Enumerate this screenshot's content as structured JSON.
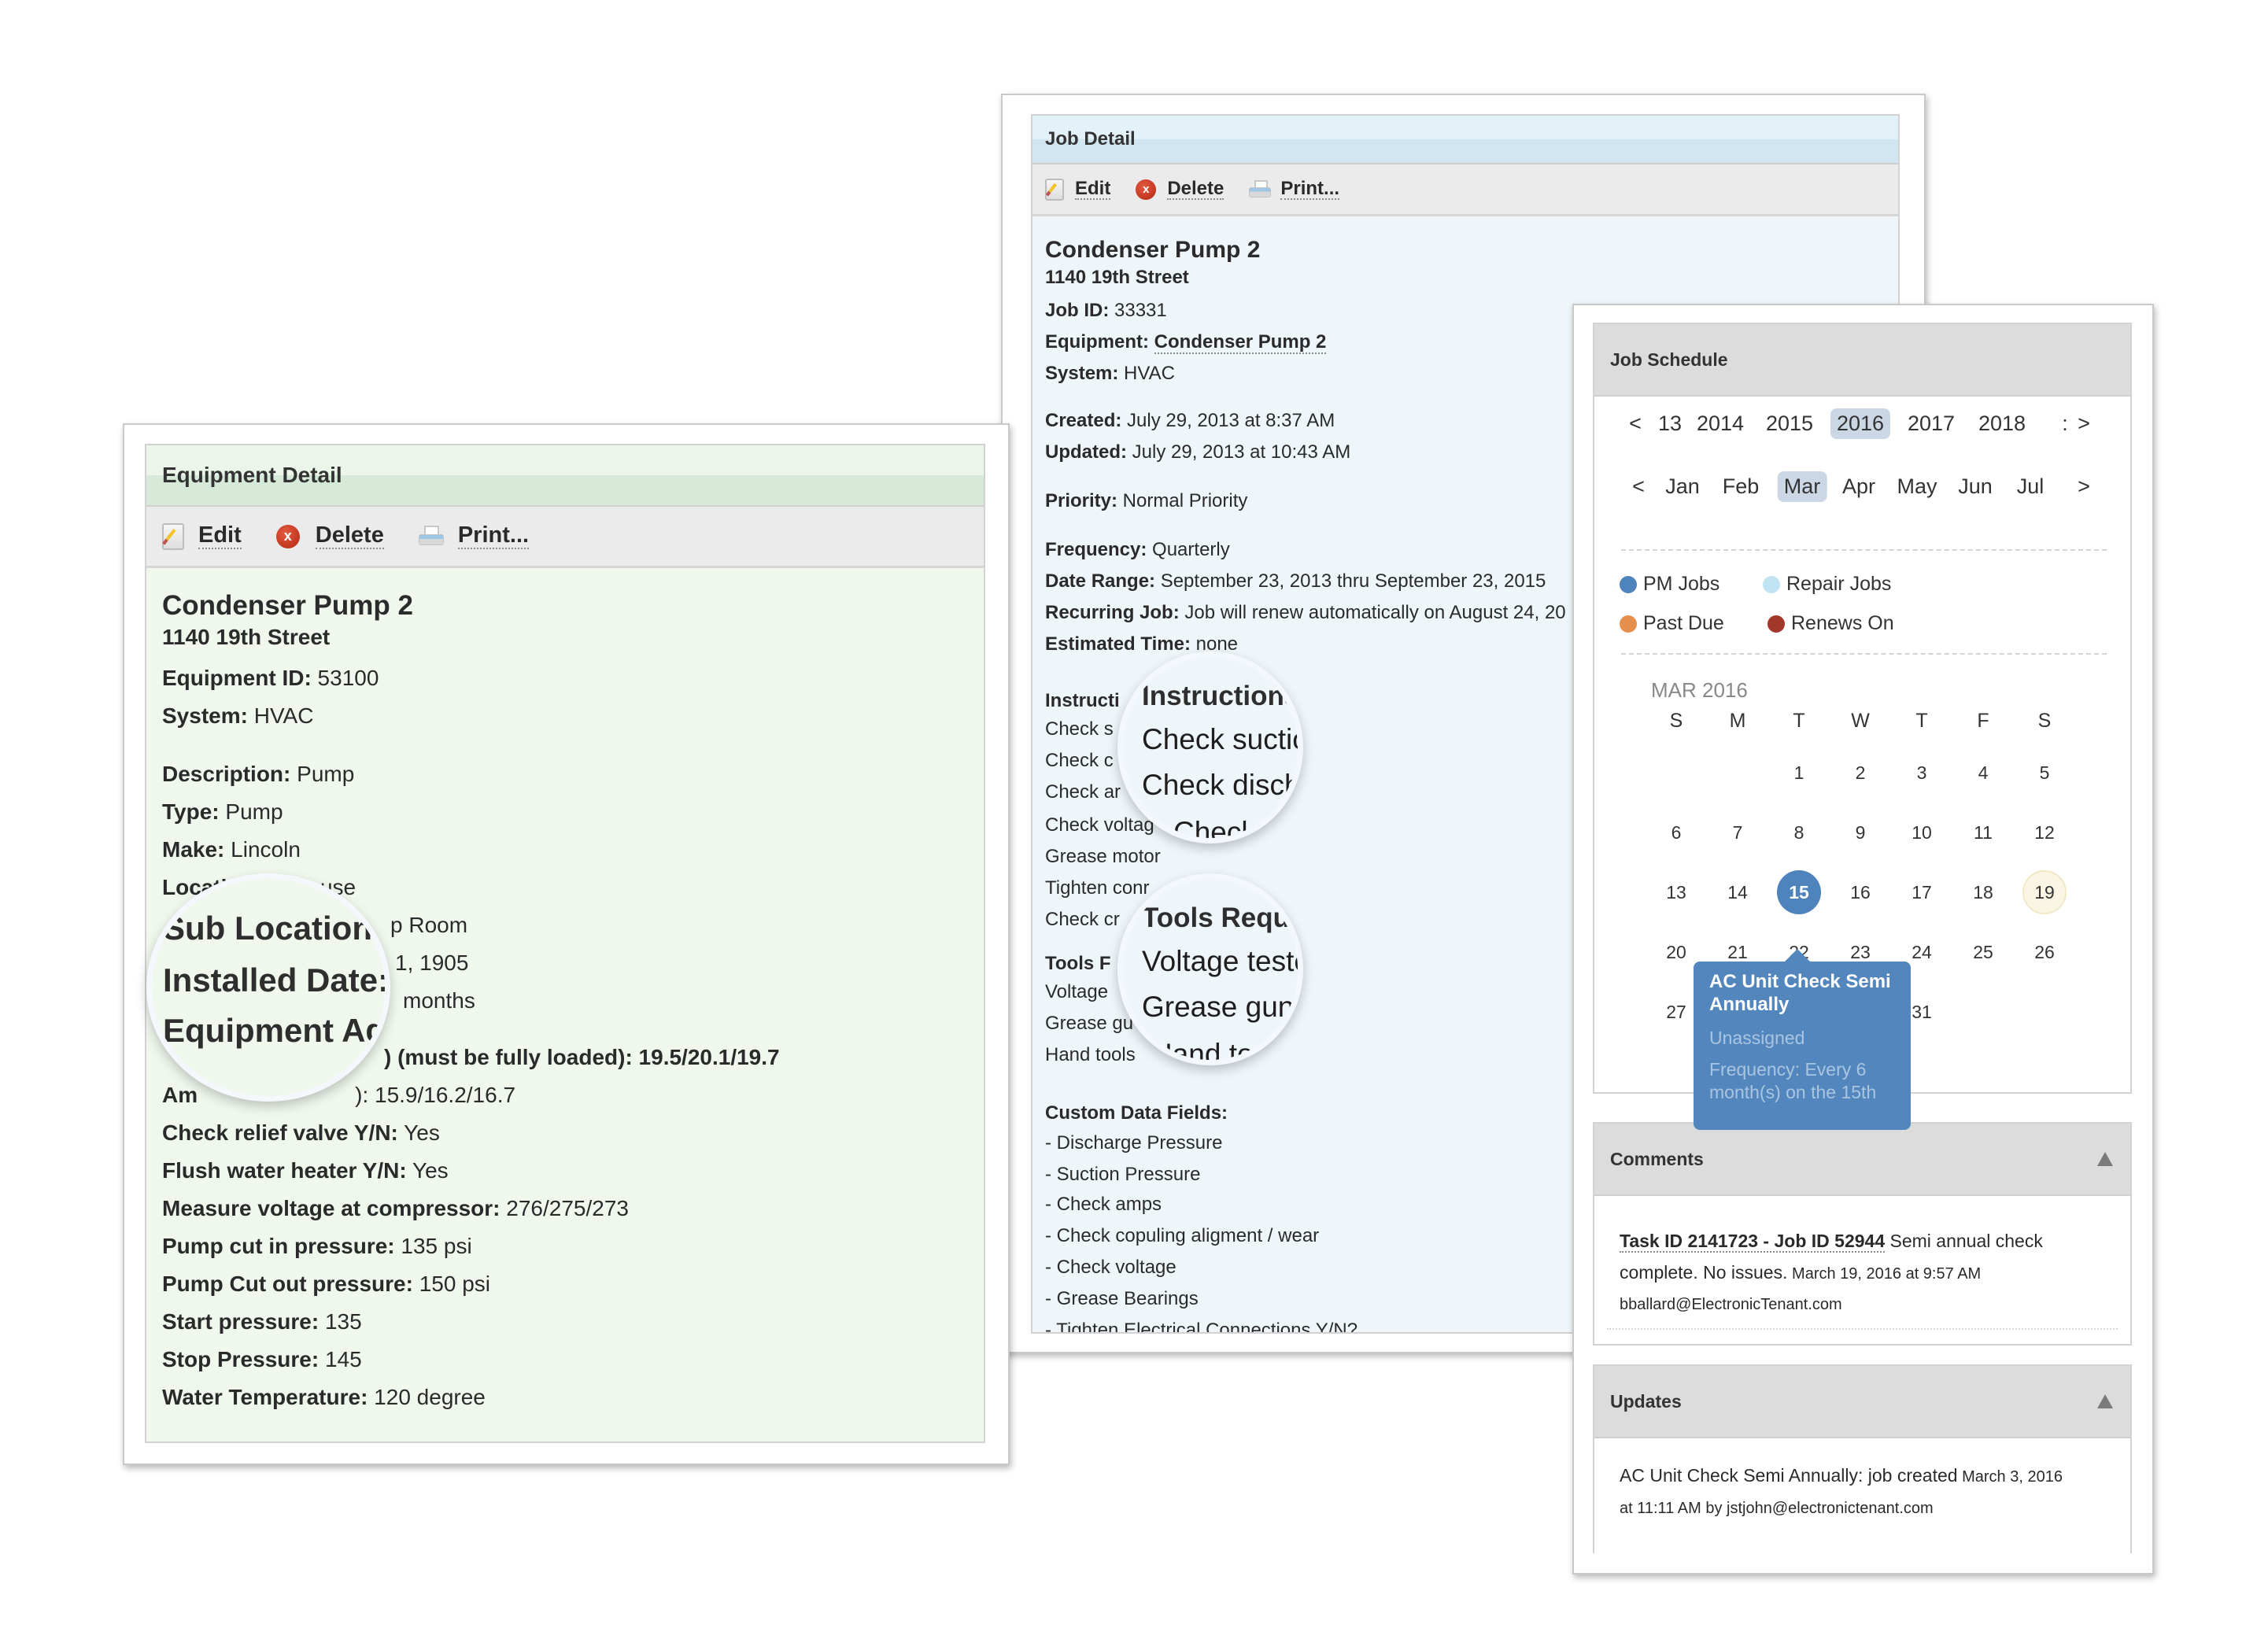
{
  "equipment_detail": {
    "header": "Equipment Detail",
    "toolbar": {
      "edit": "Edit",
      "delete": "Delete",
      "print": "Print..."
    },
    "title": "Condenser Pump 2",
    "address": "1140 19th Street",
    "fields": [
      {
        "label": "Equipment ID:",
        "value": " 53100"
      },
      {
        "label": "System:",
        "value": " HVAC"
      },
      {
        "label": "Description:",
        "value": " Pump"
      },
      {
        "label": "Type:",
        "value": " Pump"
      },
      {
        "label": "Make:",
        "value": " Lincoln"
      },
      {
        "label": "Location:",
        "value": " Penthouse"
      },
      {
        "label": "Sub Location:",
        "value": " Pump Room"
      },
      {
        "label": "Installed Date:",
        "value": " ...31, 1905"
      },
      {
        "label": "Equipment Age:",
        "value": " ... months"
      },
      {
        "label": "A... (must be fully loaded):",
        "value": " 19.5/20.1/19.7"
      },
      {
        "label": "Amp... comp(s):",
        "value": " 15.9/16.2/16.7"
      },
      {
        "label": "Check relief valve Y/N:",
        "value": " Yes"
      },
      {
        "label": "Flush water heater Y/N:",
        "value": " Yes"
      },
      {
        "label": "Measure voltage at compressor:",
        "value": " 276/275/273"
      },
      {
        "label": "Pump cut in pressure:",
        "value": " 135 psi"
      },
      {
        "label": "Pump Cut out pressure:",
        "value": " 150 psi"
      },
      {
        "label": "Start pressure:",
        "value": " 135"
      },
      {
        "label": "Stop Pressure:",
        "value": " 145"
      },
      {
        "label": "Water Temperature:",
        "value": " 120 degree"
      }
    ],
    "visible_partial": {
      "location_prefix": "Locati",
      "location_suffix": "nthouse",
      "sub_location_suffix": "p Room",
      "installed_suffix": "1, 1905",
      "age_suffix": "months",
      "amps_loaded_suffix": ") (must be fully loaded): 19.5/20.1/19.7",
      "amps_comp_prefix": "Am",
      "amps_comp_suffix": "): 15.9/16.2/16.7"
    },
    "magnifier": {
      "lines": [
        "Sub Location",
        "Installed Date:",
        "Equipment Age",
        "Amp comp"
      ]
    }
  },
  "job_detail": {
    "header": "Job Detail",
    "toolbar": {
      "edit": "Edit",
      "delete": "Delete",
      "print": "Print..."
    },
    "title": "Condenser Pump 2",
    "address": "1140 19th Street",
    "job_id": {
      "label": "Job ID:",
      "value": " 33331"
    },
    "equipment": {
      "label": "Equipment:",
      "value": "Condenser Pump 2"
    },
    "system": {
      "label": "System:",
      "value": " HVAC"
    },
    "created": {
      "label": "Created:",
      "value": " July 29, 2013 at 8:37 AM"
    },
    "updated": {
      "label": "Updated:",
      "value": " July 29, 2013 at 10:43 AM"
    },
    "priority": {
      "label": "Priority:",
      "value": " Normal Priority"
    },
    "frequency": {
      "label": "Frequency:",
      "value": " Quarterly"
    },
    "date_range": {
      "label": "Date Range:",
      "value": " September 23, 2013 thru September 23, 2015"
    },
    "recurring": {
      "label": "Recurring Job:",
      "value": " Job will renew automatically on August 24, 20"
    },
    "estimated_time": {
      "label": "Estimated Time:",
      "value": " none"
    },
    "instructions": {
      "label": "Instructions:",
      "visible_prefixes": [
        "Instructi",
        "Check s",
        "Check c",
        "Check ar",
        "Check voltag",
        "Grease motor",
        "Tighten conr",
        "Check cr"
      ],
      "magnified": [
        "Instructions",
        "Check suctio",
        "Check disch",
        "Check ar"
      ]
    },
    "tools": {
      "label": "Tools Required:",
      "visible_prefixes": [
        "Tools F",
        "Voltage",
        "Grease gu",
        "Hand tools"
      ],
      "magnified": [
        "Tools Requ",
        "Voltage teste",
        "Grease gun",
        "Hand tool"
      ]
    },
    "custom_fields": {
      "label": "Custom Data Fields:",
      "items": [
        "- Discharge Pressure",
        "- Suction Pressure",
        "- Check amps",
        "- Check copuling aligment / wear",
        "- Check voltage",
        "- Grease Bearings",
        "- Tighten Electrical Connections Y/N?"
      ]
    }
  },
  "job_schedule": {
    "header": "Job Schedule",
    "years": {
      "prev": "<",
      "next": ">",
      "items": [
        "13",
        "2014",
        "2015",
        "2016",
        "2017",
        "2018",
        ":"
      ],
      "selected": "2016"
    },
    "months": {
      "prev": "<",
      "next": ">",
      "items": [
        "Jan",
        "Feb",
        "Mar",
        "Apr",
        "May",
        "Jun",
        "Jul"
      ],
      "selected": "Mar"
    },
    "legend": [
      {
        "label": "PM Jobs",
        "color": "#4f83bc"
      },
      {
        "label": "Repair Jobs",
        "color": "#c2e4f2"
      },
      {
        "label": "Past Due",
        "color": "#e5904f"
      },
      {
        "label": "Renews On",
        "color": "#a3382a"
      }
    ],
    "month_label": "MAR 2016",
    "weekdays": [
      "S",
      "M",
      "T",
      "W",
      "T",
      "F",
      "S"
    ],
    "first_weekday_index": 2,
    "days_in_month": 31,
    "pm_job_days": [
      15
    ],
    "highlighted_day": 19,
    "tooltip": {
      "title": "AC Unit Check Semi Annually",
      "assignee": "Unassigned",
      "frequency": "Frequency: Every 6 month(s) on the 15th"
    }
  },
  "comments": {
    "header": "Comments",
    "items": [
      {
        "link": "Task ID 2141723 - Job ID 52944",
        "text": " Semi annual check complete. No issues.",
        "timestamp": " March 19, 2016 at 9:57 AM",
        "author": "bballard@ElectronicTenant.com"
      }
    ]
  },
  "updates": {
    "header": "Updates",
    "items": [
      {
        "text": "AC Unit Check Semi Annually: job created",
        "timestamp": " March 3, 2016",
        "byline": "at 11:11 AM by jstjohn@electronictenant.com"
      }
    ]
  }
}
